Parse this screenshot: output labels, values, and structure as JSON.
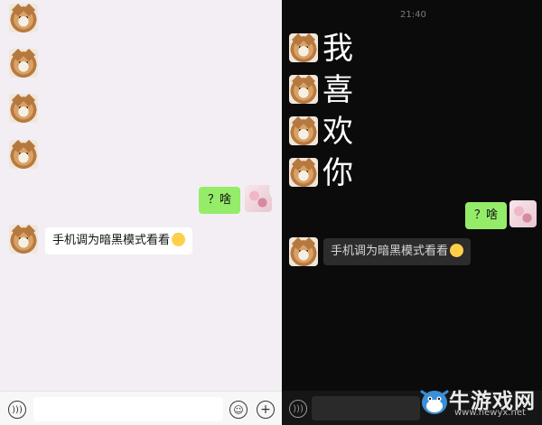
{
  "light_chat": {
    "messages": [
      {
        "from": "friend",
        "type": "sticker"
      },
      {
        "from": "friend",
        "type": "sticker"
      },
      {
        "from": "friend",
        "type": "sticker"
      },
      {
        "from": "friend",
        "type": "sticker"
      },
      {
        "from": "me",
        "type": "text",
        "text": "？啥"
      },
      {
        "from": "friend",
        "type": "text",
        "text": "手机调为暗黑模式看看"
      }
    ]
  },
  "dark_chat": {
    "time": "21:40",
    "messages": [
      {
        "from": "friend",
        "type": "big_text",
        "text": "我"
      },
      {
        "from": "friend",
        "type": "big_text",
        "text": "喜"
      },
      {
        "from": "friend",
        "type": "big_text",
        "text": "欢"
      },
      {
        "from": "friend",
        "type": "big_text",
        "text": "你"
      },
      {
        "from": "me",
        "type": "text",
        "text": "？啥"
      },
      {
        "from": "friend",
        "type": "text",
        "text": "手机调为暗黑模式看看"
      }
    ]
  },
  "icons": {
    "voice": "voice-icon",
    "emoji": "emoji-icon",
    "plus": "plus-icon"
  },
  "watermark": {
    "text": "牛游戏网",
    "url": "www.newyx.net"
  },
  "colors": {
    "my_bubble": "#95ec69",
    "light_bg": "#f3eef4",
    "dark_bg": "#0b0b0b"
  }
}
